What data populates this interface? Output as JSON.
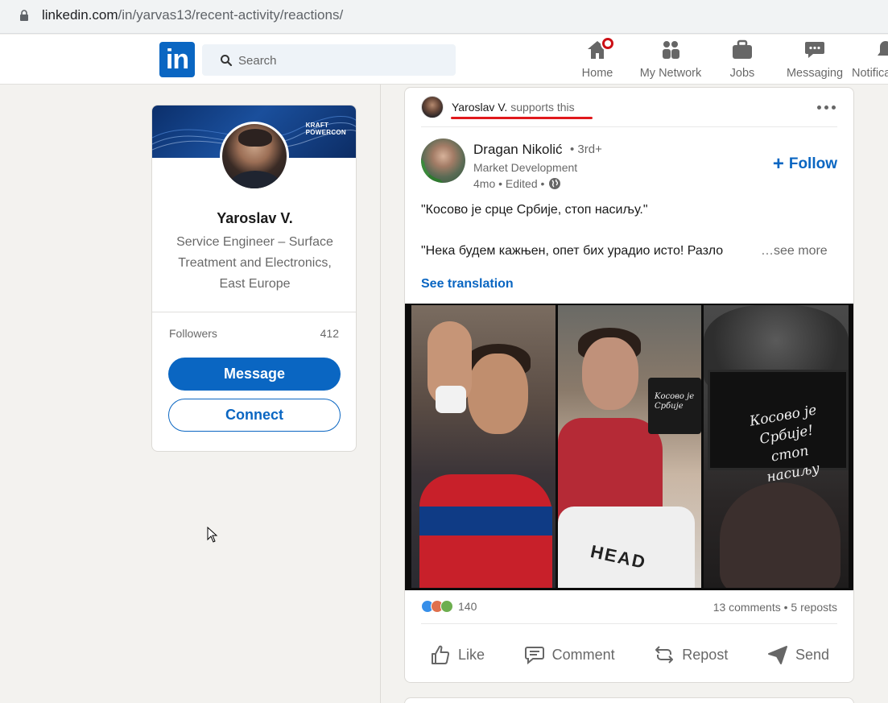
{
  "browser": {
    "url_host": "linkedin.com",
    "url_path": "/in/yarvas13/recent-activity/reactions/"
  },
  "nav": {
    "logo_text": "in",
    "search_placeholder": "Search",
    "items": [
      {
        "label": "Home",
        "icon": "home-icon",
        "notification": true
      },
      {
        "label": "My Network",
        "icon": "network-icon"
      },
      {
        "label": "Jobs",
        "icon": "briefcase-icon"
      },
      {
        "label": "Messaging",
        "icon": "messaging-icon"
      },
      {
        "label": "Notifications",
        "icon": "bell-icon"
      }
    ]
  },
  "profile": {
    "name": "Yaroslav V.",
    "headline": "Service Engineer – Surface Treatment and Electronics, East Europe",
    "banner_logo_line1": "KRAFT",
    "banner_logo_line2": "POWERCON",
    "followers_label": "Followers",
    "followers_count": "412",
    "message_label": "Message",
    "connect_label": "Connect"
  },
  "post": {
    "context_name": "Yaroslav V.",
    "context_action": "supports this",
    "author_name": "Dragan Nikolić",
    "author_degree": "• 3rd+",
    "author_title": "Market Development",
    "author_meta": "4mo • Edited •",
    "follow_label": "Follow",
    "text_line1": "\"Косово је срце Србије, стоп насиљу.\"",
    "text_line2": "\"Нека будем кажњен, опет бих урадио исто! Разло",
    "see_more": "…see more",
    "see_translation": "See translation",
    "image_text_bag": "HEAD",
    "image_text_camera_small": "Kосово је Србије",
    "image_text_camera_large": "Косово је Србије! стоп насиљу",
    "reactions_count": "140",
    "counts_right": "13 comments • 5 reposts",
    "actions": {
      "like": "Like",
      "comment": "Comment",
      "repost": "Repost",
      "send": "Send"
    }
  },
  "colors": {
    "brand": "#0a66c2",
    "notification": "#cc1016",
    "underline": "#e0181c",
    "page_bg": "#f3f2ef"
  }
}
